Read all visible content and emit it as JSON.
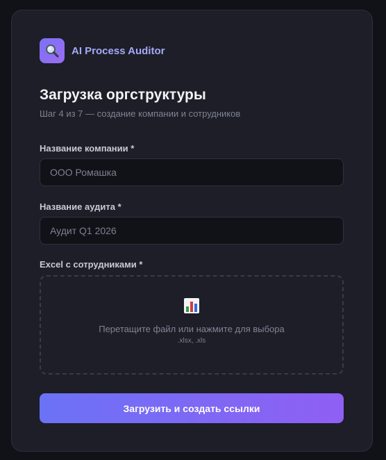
{
  "brand": {
    "name": "AI Process Auditor",
    "icon": "magnifier-icon"
  },
  "page": {
    "title": "Загрузка оргструктуры",
    "subtitle": "Шаг 4 из 7 — создание компании и сотрудников"
  },
  "form": {
    "company": {
      "label": "Название компании *",
      "placeholder": "ООО Ромашка",
      "value": ""
    },
    "audit": {
      "label": "Название аудита *",
      "placeholder": "Аудит Q1 2026",
      "value": ""
    },
    "excel": {
      "label": "Excel с сотрудниками *",
      "icon": "bar-chart-icon",
      "dropzone_text": "Перетащите файл или нажмите для выбора",
      "dropzone_hint": ".xlsx, .xls"
    },
    "submit_label": "Загрузить и создать ссылки"
  },
  "colors": {
    "background": "#111217",
    "card": "#1d1e27",
    "accent_start": "#6b72f6",
    "accent_end": "#8f5ff3",
    "brand_text": "#a5a9f8"
  }
}
